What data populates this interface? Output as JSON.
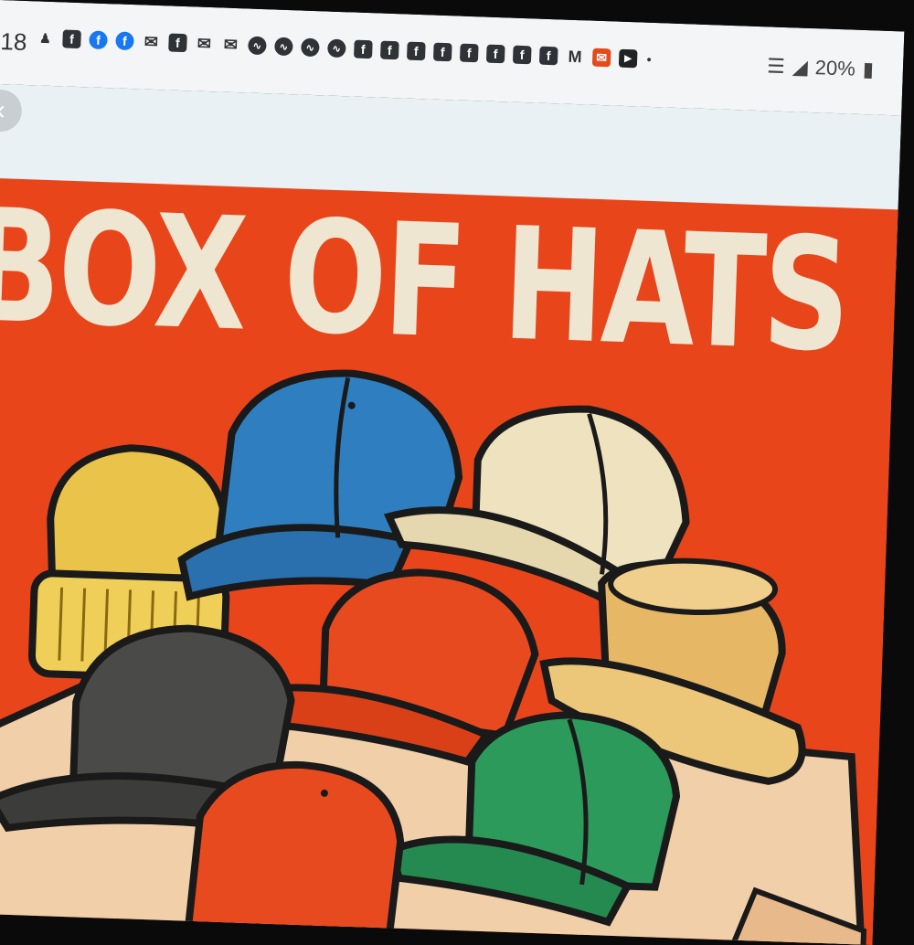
{
  "status_bar": {
    "time": "18",
    "notification_icons": [
      "person-icon",
      "facebook-icon",
      "facebook-circle-icon",
      "facebook-circle-icon",
      "chat-icon",
      "facebook-icon",
      "chat-icon",
      "chat-icon",
      "messenger-icon",
      "messenger-icon",
      "messenger-icon",
      "messenger-icon",
      "facebook-icon",
      "facebook-icon",
      "facebook-icon",
      "facebook-icon",
      "facebook-icon",
      "facebook-icon",
      "facebook-icon",
      "facebook-icon",
      "gmail-icon",
      "mail-app-icon",
      "youtube-icon",
      "dot-icon"
    ],
    "battery": "20%"
  },
  "app_bar": {
    "back_icon": "chevron-left-icon"
  },
  "poster": {
    "title": "BOX OF HATS",
    "background": "#e8461a",
    "title_color": "#efe6d2",
    "hats": [
      {
        "name": "beanie",
        "color": "#e9c34a"
      },
      {
        "name": "blue-cap",
        "color": "#2f7fc0"
      },
      {
        "name": "cream-cap",
        "color": "#efe3bf"
      },
      {
        "name": "bucket-hat",
        "color": "#e6b865"
      },
      {
        "name": "red-cap",
        "color": "#e84a1f"
      },
      {
        "name": "gray-cap",
        "color": "#4a4a48"
      },
      {
        "name": "green-cap",
        "color": "#2c9a5b"
      },
      {
        "name": "red-cap-front",
        "color": "#e84a1f"
      }
    ],
    "box_color": "#f1cfa8"
  }
}
